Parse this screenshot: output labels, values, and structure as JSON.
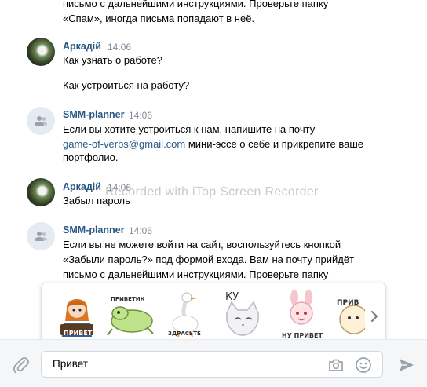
{
  "messages": {
    "top_line_1": "письмо с дальнейшими инструкциями. Проверьте папку",
    "top_line_2": "«Спам», иногда письма попадают в неё.",
    "m1": {
      "author": "Аркадій",
      "time": "14:06",
      "line1": "Как узнать о работе?",
      "line2": "Как устроиться на работу?"
    },
    "m2": {
      "author": "SMM-planner",
      "time": "14:06",
      "line1": "Если вы хотите устроиться к нам, напишите на почту",
      "link": "game-of-verbs@gmail.com",
      "line2_rest": " мини-эссе о себе и прикрепите ваше",
      "line3": "портфолио."
    },
    "m3": {
      "author": "Аркадій",
      "time": "14:06",
      "line1": "Забыл пароль"
    },
    "m4": {
      "author": "SMM-planner",
      "time": "14:06",
      "line1": "Если вы не можете войти на сайт, воспользуйтесь кнопкой",
      "line2": "«Забыли пароль?» под формой входа. Вам на почту прийдёт",
      "line3": "письмо с дальнейшими инструкциями. Проверьте папку"
    }
  },
  "watermark": "Recorded with iTop Screen Recorder",
  "stickers": {
    "s1_label": "ПРИВЕТ",
    "s2_label": "ПРИВЕТИК",
    "s3_label": "ЗДРАСЬТЕ",
    "s4_label": "КУ",
    "s5_label": "НУ ПРИВЕТ",
    "s6_label": "ПРИВ"
  },
  "composer": {
    "value": "Привет"
  },
  "colors": {
    "link": "#2a5885",
    "meta": "#818c99",
    "icon": "#99a2ad"
  }
}
